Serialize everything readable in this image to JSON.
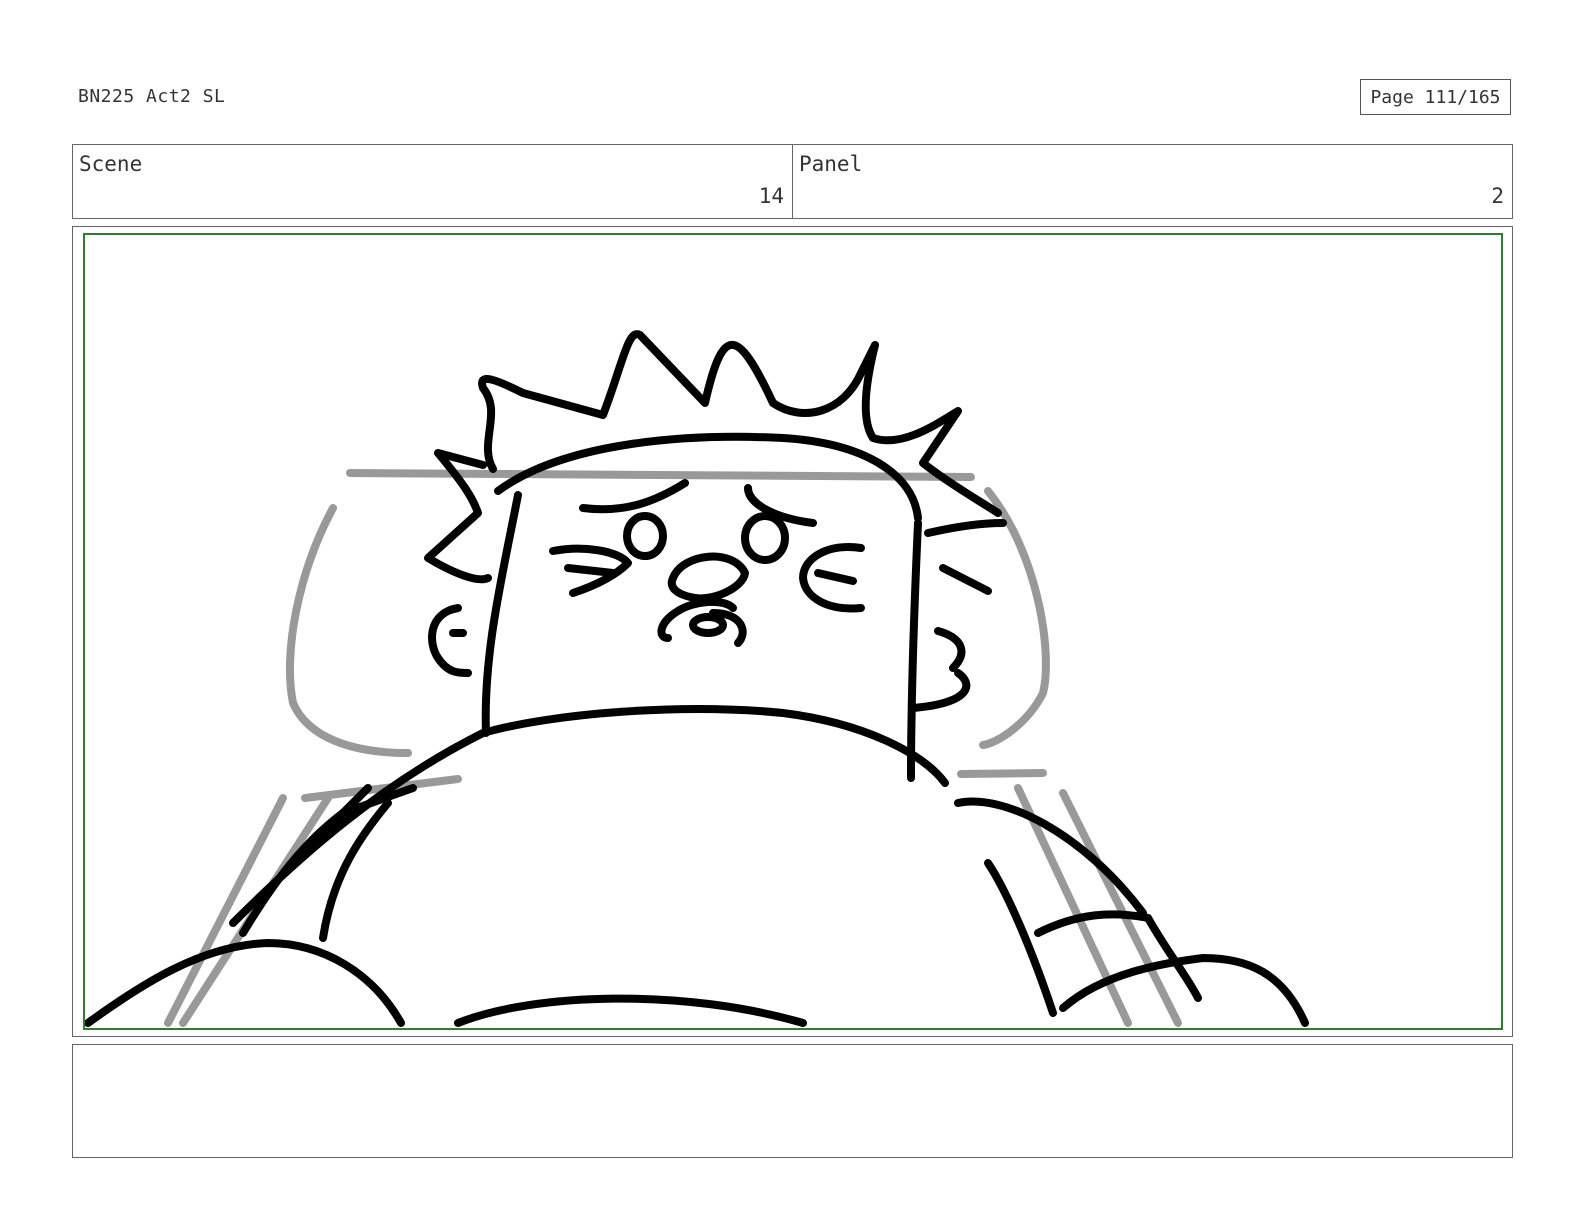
{
  "header": {
    "doc_title": "BN225 Act2 SL",
    "page_label": "Page 111/165"
  },
  "info": {
    "scene_label": "Scene",
    "scene_value": "14",
    "panel_label": "Panel",
    "panel_value": "2"
  },
  "notes": {
    "text": ""
  },
  "colors": {
    "safe_frame": "#2e7d32",
    "ink": "#000000",
    "rough": "#999999"
  }
}
